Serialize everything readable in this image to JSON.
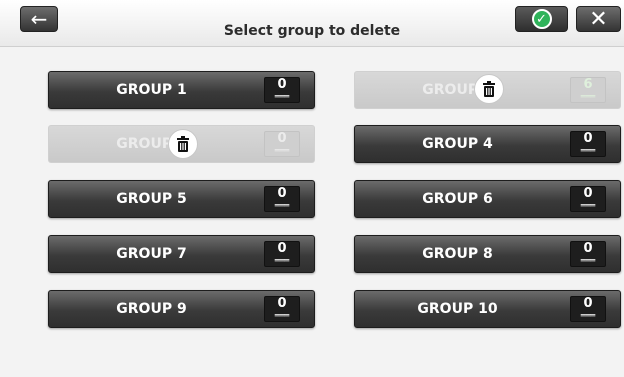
{
  "header": {
    "title": "Select group to delete",
    "back_icon": "arrow-left-icon",
    "confirm_icon": "check-icon",
    "close_icon": "close-icon"
  },
  "groups": [
    {
      "label": "GROUP 1",
      "count": "0",
      "selected": false
    },
    {
      "label": "GROUP 2",
      "count": "6",
      "selected": true
    },
    {
      "label": "GROUP 3",
      "count": "0",
      "selected": true
    },
    {
      "label": "GROUP 4",
      "count": "0",
      "selected": false
    },
    {
      "label": "GROUP 5",
      "count": "0",
      "selected": false
    },
    {
      "label": "GROUP 6",
      "count": "0",
      "selected": false
    },
    {
      "label": "GROUP 7",
      "count": "0",
      "selected": false
    },
    {
      "label": "GROUP 8",
      "count": "0",
      "selected": false
    },
    {
      "label": "GROUP 9",
      "count": "0",
      "selected": false
    },
    {
      "label": "GROUP 10",
      "count": "0",
      "selected": false
    }
  ],
  "colors": {
    "confirm_green": "#2fb35a",
    "button_dark": "#333333",
    "selected_bg": "#cfcfcf"
  }
}
